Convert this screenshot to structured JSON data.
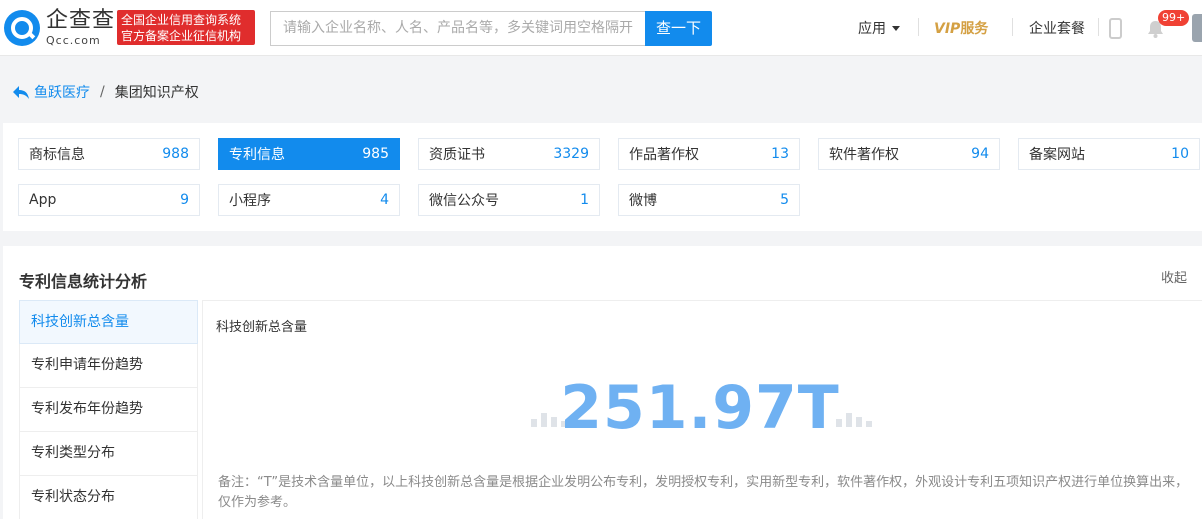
{
  "header": {
    "logo_cn": "企查查",
    "logo_en": "Qcc.com",
    "badge_line1": "全国企业信用查询系统",
    "badge_line2": "官方备案企业征信机构",
    "search_placeholder": "请输入企业名称、人名、产品名等，多关键词用空格隔开",
    "search_button": "查一下",
    "nav_app": "应用",
    "nav_vip_prefix": "VIP",
    "nav_vip_suffix": "服务",
    "nav_package": "企业套餐",
    "notification_count": "99+"
  },
  "breadcrumb": {
    "parent": "鱼跃医疗",
    "separator": "/",
    "current": "集团知识产权"
  },
  "tags": [
    {
      "label": "商标信息",
      "count": "988",
      "active": false
    },
    {
      "label": "专利信息",
      "count": "985",
      "active": true
    },
    {
      "label": "资质证书",
      "count": "3329",
      "active": false
    },
    {
      "label": "作品著作权",
      "count": "13",
      "active": false
    },
    {
      "label": "软件著作权",
      "count": "94",
      "active": false
    },
    {
      "label": "备案网站",
      "count": "10",
      "active": false
    },
    {
      "label": "App",
      "count": "9",
      "active": false
    },
    {
      "label": "小程序",
      "count": "4",
      "active": false
    },
    {
      "label": "微信公众号",
      "count": "1",
      "active": false
    },
    {
      "label": "微博",
      "count": "5",
      "active": false
    }
  ],
  "stats": {
    "title": "专利信息统计分析",
    "collapse": "收起",
    "menu": [
      {
        "label": "科技创新总含量",
        "active": true
      },
      {
        "label": "专利申请年份趋势",
        "active": false
      },
      {
        "label": "专利发布年份趋势",
        "active": false
      },
      {
        "label": "专利类型分布",
        "active": false
      },
      {
        "label": "专利状态分布",
        "active": false
      }
    ],
    "content_title": "科技创新总含量",
    "value": "251.97T",
    "note": "备注：“T”是技术含量单位，以上科技创新总含量是根据企业发明公布专利，发明授权专利，实用新型专利，软件著作权，外观设计专利五项知识产权进行单位换算出来，仅作为参考。"
  },
  "colors": {
    "brand": "#128bed",
    "accent_red": "#e02d2d",
    "vip_gold": "#d4a043",
    "value_blue": "#6fb1f2"
  }
}
